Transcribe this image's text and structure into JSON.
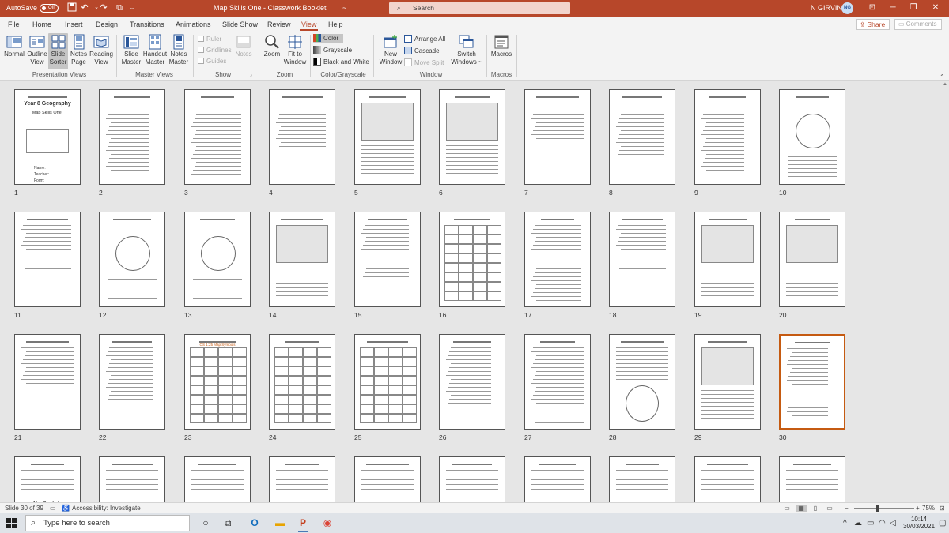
{
  "titlebar": {
    "autosave_label": "AutoSave",
    "autosave_state": "Off",
    "doc_title": "Map Skills One - Classwork Booklet",
    "app_suffix": "~",
    "search_placeholder": "Search",
    "user_name": "N GIRVIN",
    "user_initials": "NG",
    "quick_access_icons": [
      "save-icon",
      "undo-icon",
      "redo-icon",
      "start-from-beginning-icon",
      "customize-icon"
    ]
  },
  "menu": {
    "tabs": [
      "File",
      "Home",
      "Insert",
      "Design",
      "Transitions",
      "Animations",
      "Slide Show",
      "Review",
      "View",
      "Help"
    ],
    "active_tab": "View",
    "share_label": "Share",
    "comments_label": "Comments"
  },
  "ribbon": {
    "presentation_views": {
      "label": "Presentation Views",
      "buttons": [
        {
          "line1": "Normal",
          "line2": ""
        },
        {
          "line1": "Outline",
          "line2": "View"
        },
        {
          "line1": "Slide",
          "line2": "Sorter"
        },
        {
          "line1": "Notes",
          "line2": "Page"
        },
        {
          "line1": "Reading",
          "line2": "View"
        }
      ],
      "selected": "Slide Sorter"
    },
    "master_views": {
      "label": "Master Views",
      "buttons": [
        {
          "line1": "Slide",
          "line2": "Master"
        },
        {
          "line1": "Handout",
          "line2": "Master"
        },
        {
          "line1": "Notes",
          "line2": "Master"
        }
      ]
    },
    "show": {
      "label": "Show",
      "checks": [
        "Ruler",
        "Gridlines",
        "Guides"
      ],
      "notes_label": "Notes"
    },
    "zoom": {
      "label": "Zoom",
      "zoom_label": "Zoom",
      "fit_line1": "Fit to",
      "fit_line2": "Window"
    },
    "color_grayscale": {
      "label": "Color/Grayscale",
      "options": [
        "Color",
        "Grayscale",
        "Black and White"
      ],
      "selected": "Color"
    },
    "window": {
      "label": "Window",
      "new_line1": "New",
      "new_line2": "Window",
      "arrange_all": "Arrange All",
      "cascade": "Cascade",
      "move_split": "Move Split",
      "switch_line1": "Switch",
      "switch_line2": "Windows ~"
    },
    "macros": {
      "label": "Macros",
      "button": "Macros"
    }
  },
  "slides": {
    "selected": 30,
    "numbers": [
      "1",
      "2",
      "3",
      "4",
      "5",
      "6",
      "7",
      "8",
      "9",
      "10",
      "11",
      "12",
      "13",
      "14",
      "15",
      "16",
      "17",
      "18",
      "19",
      "20",
      "21",
      "22",
      "23",
      "24",
      "25",
      "26",
      "27",
      "28",
      "29",
      "30"
    ],
    "slide1": {
      "title": "Year 8 Geography",
      "subtitle": "Map Skills One:",
      "lines": [
        "Name:",
        "Teacher:",
        "Form:"
      ]
    },
    "slide23_title": "OS 1:25 Map Symbols",
    "slide31_title": "Map Symbols"
  },
  "statusbar": {
    "slide_info": "Slide 30 of 39",
    "accessibility": "Accessibility: Investigate",
    "zoom_level": "75%"
  },
  "taskbar": {
    "search_placeholder": "Type here to search",
    "time": "10:14",
    "date": "30/03/2021"
  },
  "colors": {
    "accent": "#b7472a",
    "selected_slide_border": "#c55a11"
  }
}
